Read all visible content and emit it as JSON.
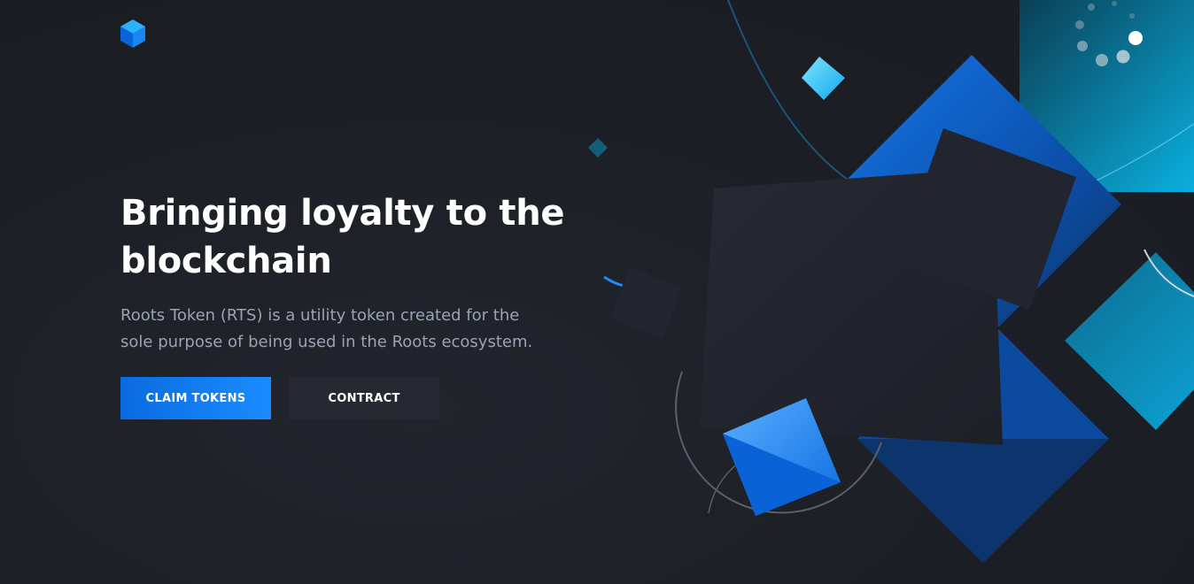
{
  "brand": {
    "logo_icon": "cube-logo-icon"
  },
  "hero": {
    "title": "Bringing loyalty to the blockchain",
    "description": "Roots Token (RTS) is a utility token created for the sole purpose of being used in the Roots ecosystem."
  },
  "actions": {
    "claim_label": "CLAIM TOKENS",
    "contract_label": "CONTRACT"
  },
  "colors": {
    "background": "#1c1e25",
    "primary": "#0a6be0",
    "accent": "#1a8cff",
    "secondary_button": "#262931",
    "text": "#ffffff",
    "muted_text": "#9aa2b4"
  }
}
